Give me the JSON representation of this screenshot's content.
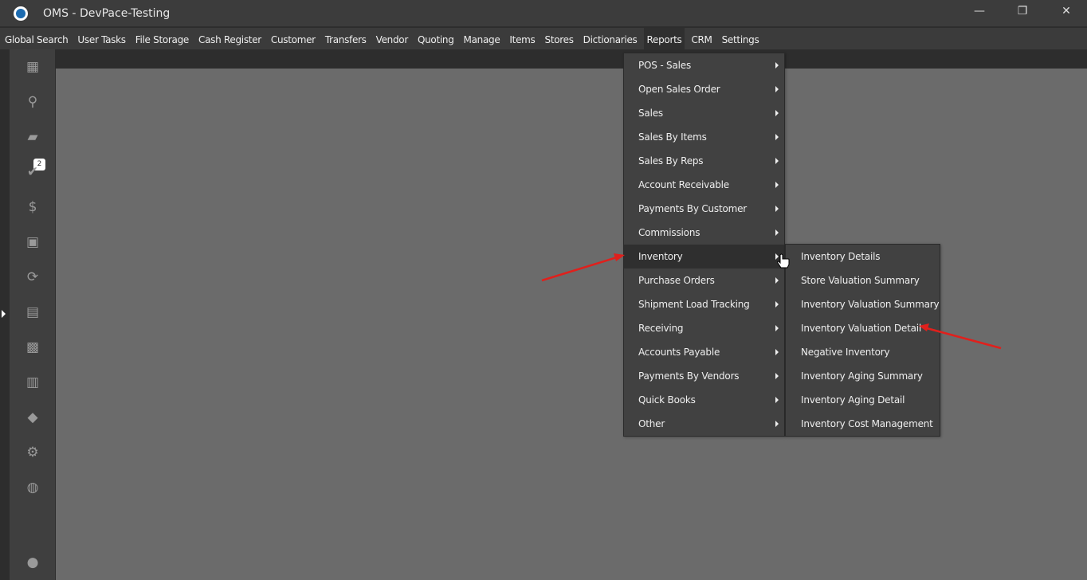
{
  "window": {
    "title": "OMS - DevPace-Testing",
    "minimize": "—",
    "restore": "❐",
    "close": "✕"
  },
  "menubar": [
    "Global Search",
    "User Tasks",
    "File Storage",
    "Cash Register",
    "Customer",
    "Transfers",
    "Vendor",
    "Quoting",
    "Manage",
    "Items",
    "Stores",
    "Dictionaries",
    "Reports",
    "CRM",
    "Settings"
  ],
  "active_menu": "Reports",
  "sidebar": {
    "task_badge": "2",
    "icons": [
      "dashboard-icon",
      "search-icon",
      "folder-icon",
      "tasks-icon",
      "dollar-icon",
      "contact-icon",
      "transfer-icon",
      "store-icon",
      "quoting-icon",
      "clipboard-icon",
      "tag-icon",
      "gear-icon",
      "globe-icon",
      "user-icon"
    ]
  },
  "reports_menu": [
    "POS - Sales",
    "Open Sales Order",
    "Sales",
    "Sales By Items",
    "Sales By Reps",
    "Account Receivable",
    "Payments By Customer",
    "Commissions",
    "Inventory",
    "Purchase Orders",
    "Shipment Load Tracking",
    "Receiving",
    "Accounts Payable",
    "Payments By Vendors",
    "Quick Books",
    "Other"
  ],
  "hovered_item": "Inventory",
  "inventory_submenu": [
    "Inventory Details",
    "Store Valuation Summary",
    "Inventory Valuation Summary",
    "Inventory Valuation Detail",
    "Negative Inventory",
    "Inventory Aging Summary",
    "Inventory Aging Detail",
    "Inventory Cost Management"
  ],
  "annotation_color": "#e0201c"
}
